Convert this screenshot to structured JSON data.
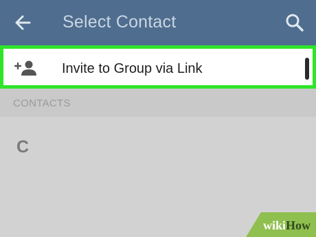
{
  "header": {
    "title": "Select Contact",
    "back_icon": "arrow-left-icon",
    "search_icon": "search-icon"
  },
  "invite": {
    "label": "Invite to Group via Link",
    "icon": "person-add-icon"
  },
  "contacts": {
    "section_label": "CONTACTS",
    "first_letter": "C"
  },
  "watermark": {
    "wiki": "wiki",
    "how": "How"
  },
  "colors": {
    "appbar": "#4f6d8e",
    "highlight": "#2fe52a",
    "background": "#d2d2d2"
  }
}
